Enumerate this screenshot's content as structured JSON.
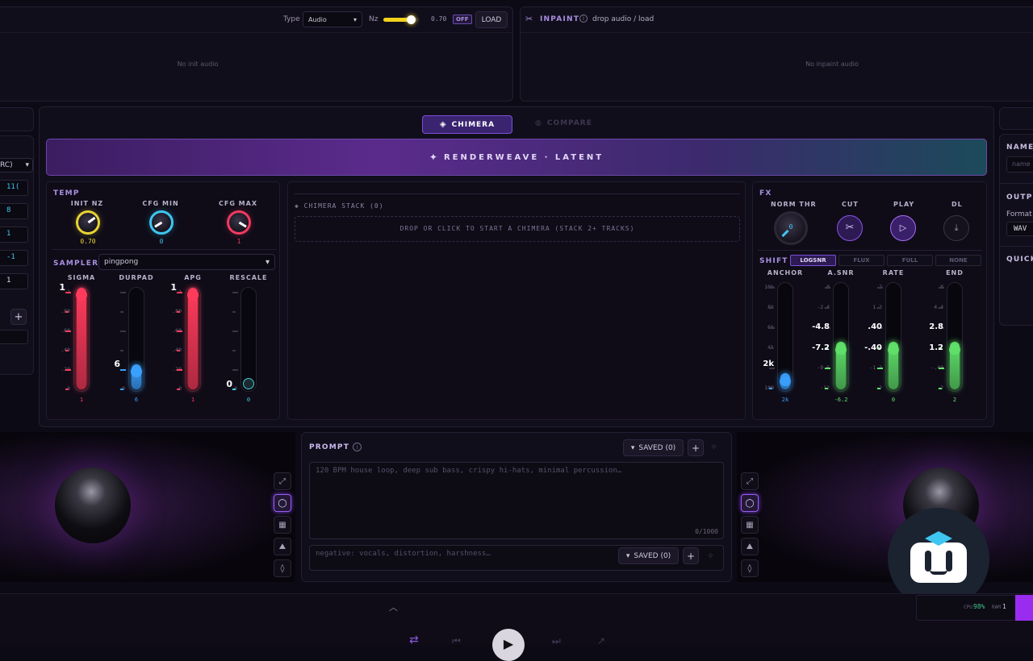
{
  "init_panel": {
    "type_label": "Type",
    "type_value": "Audio",
    "nz_label": "Nz",
    "nz_value": "0.70",
    "nz_level": 0.78,
    "off_badge": "OFF",
    "load_label": "LOAD",
    "empty_text": "No init audio"
  },
  "inpaint_panel": {
    "title": "INPAINT",
    "hint": "drop audio / load",
    "empty_text": "No inpaint audio"
  },
  "left_partial": {
    "select_value": "RC)",
    "values": [
      "11(",
      "8",
      "1",
      "-1",
      "1"
    ]
  },
  "tabs": [
    {
      "label": "CHIMERA",
      "active": true
    },
    {
      "label": "COMPARE",
      "active": false
    }
  ],
  "banner": {
    "label": "RENDERWEAVE · LATENT"
  },
  "temp": {
    "title": "TEMP",
    "knobs": [
      {
        "label": "INIT NZ",
        "value": "0.70",
        "color": "#e8d233",
        "level": 0.7
      },
      {
        "label": "CFG MIN",
        "value": "0",
        "color": "#3ec6f0",
        "level": 0.05
      },
      {
        "label": "CFG MAX",
        "value": "1",
        "color": "#f03a5f",
        "level": 0.95
      }
    ]
  },
  "sampler": {
    "label": "SAMPLER",
    "value": "pingpong",
    "faders": [
      {
        "label": "SIGMA",
        "big": "1",
        "value": "1",
        "color": "#ff3b5c",
        "level": 1.0,
        "ticks": [
          "1",
          ".80",
          ".60",
          ".40",
          ".20",
          "0"
        ]
      },
      {
        "label": "DURPAD",
        "big": "6",
        "value": "6",
        "color": "#3aa0ff",
        "level": 0.25,
        "ticks": [
          "",
          "",
          "",
          "",
          "",
          "0"
        ]
      },
      {
        "label": "APG",
        "big": "1",
        "value": "1",
        "color": "#ff3b5c",
        "level": 1.0,
        "ticks": [
          "1",
          ".80",
          ".60",
          ".40",
          ".20",
          "0"
        ]
      },
      {
        "label": "RESCALE",
        "big": "0",
        "value": "0",
        "color": "#3ed0d8",
        "level": 0.0,
        "ticks": [
          "",
          "",
          "",
          "",
          "",
          "0"
        ]
      }
    ]
  },
  "chimera_stack": {
    "title": "CHIMERA STACK (0)",
    "drop_text": "DROP OR CLICK TO START A CHIMERA (STACK 2+ TRACKS)"
  },
  "fx": {
    "title": "FX",
    "norm_label": "NORM THR",
    "norm_value": "0",
    "cut_label": "CUT",
    "play_label": "PLAY",
    "dl_label": "DL"
  },
  "shift": {
    "title": "SHIFT",
    "modes": [
      {
        "label": "LOGSNR",
        "active": true
      },
      {
        "label": "FLUX",
        "active": false
      },
      {
        "label": "FULL",
        "active": false
      },
      {
        "label": "NONE",
        "active": false
      }
    ],
    "faders": [
      {
        "label": "ANCHOR",
        "value": "2k",
        "color": "#3aa0ff",
        "level": 0.15,
        "big": [
          "2k"
        ],
        "ticks": [
          "10k",
          "8k",
          "6k",
          "4k",
          "",
          "100"
        ]
      },
      {
        "label": "A.SNR",
        "value": "-6.2",
        "color": "#5fe06a",
        "level": 0.45,
        "big": [
          "-4.8",
          "-7.2"
        ],
        "ticks": [
          "0",
          "-2.4",
          "",
          "",
          "-9.6",
          "-12"
        ]
      },
      {
        "label": "RATE",
        "value": "0",
        "color": "#5fe06a",
        "level": 0.45,
        "big": [
          ".40",
          "-.40"
        ],
        "ticks": [
          "2",
          "1.2",
          "",
          "",
          "-1.2",
          "-2"
        ]
      },
      {
        "label": "END",
        "value": "2",
        "color": "#5fe06a",
        "level": 0.45,
        "big": [
          "2.8",
          "1.2"
        ],
        "ticks": [
          "8",
          "4.4",
          "",
          "",
          "-.40",
          "-2"
        ]
      }
    ]
  },
  "right_partial": {
    "name_label": "NAME",
    "name_placeholder": "name",
    "output_label": "OUTPU",
    "format_label": "Format",
    "format_value": "WAV",
    "quick_label": "QUICK"
  },
  "prompt": {
    "title": "PROMPT",
    "saved_label": "SAVED (0)",
    "placeholder": "120 BPM house loop, deep sub bass, crispy hi-hats, minimal percussion…",
    "counter": "0/1000",
    "negative_placeholder": "negative: vocals, distortion, harshness…",
    "neg_saved_label": "SAVED (0)"
  },
  "status": {
    "cpu_label": "CPU",
    "cpu_value": "98%",
    "ram_label": "RAM",
    "ram_value": "1"
  }
}
